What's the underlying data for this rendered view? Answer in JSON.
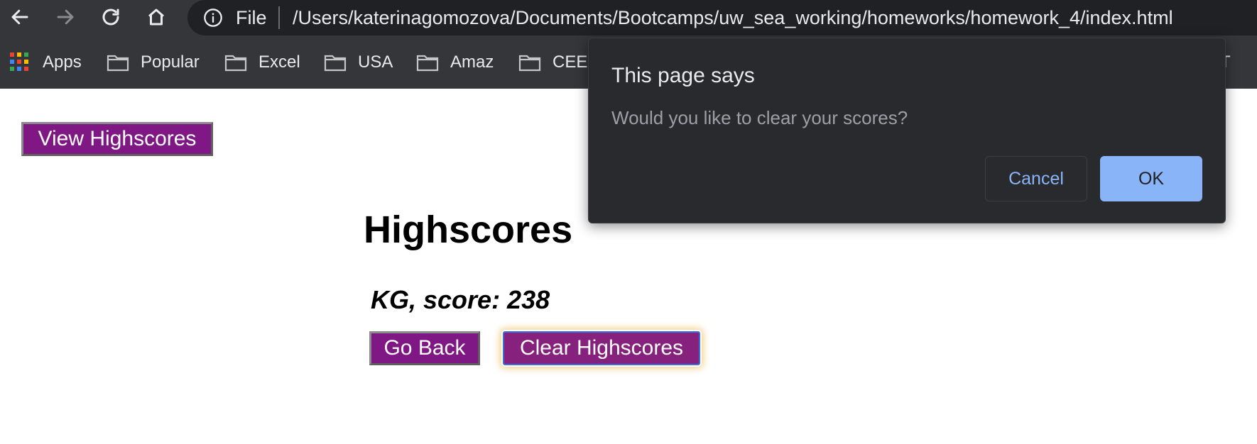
{
  "browser": {
    "scheme_label": "File",
    "url": "/Users/katerinagomozova/Documents/Bootcamps/uw_sea_working/homeworks/homework_4/index.html",
    "bookmarks": [
      {
        "label": "Apps",
        "icon": "apps-grid-icon"
      },
      {
        "label": "Popular",
        "icon": "folder-icon"
      },
      {
        "label": "Excel",
        "icon": "folder-icon"
      },
      {
        "label": "USA",
        "icon": "folder-icon"
      },
      {
        "label": "Amaz",
        "icon": "folder-icon"
      },
      {
        "label": "CEE",
        "icon": "folder-icon"
      },
      {
        "label": "T",
        "icon": "folder-icon"
      }
    ]
  },
  "page": {
    "view_highscores_label": "View Highscores",
    "heading": "Highscores",
    "score_line": "KG, score: 238",
    "go_back_label": "Go Back",
    "clear_highscores_label": "Clear Highscores",
    "button_color": "#7f1784"
  },
  "dialog": {
    "title": "This page says",
    "message": "Would you like to clear your scores?",
    "cancel_label": "Cancel",
    "ok_label": "OK",
    "accent_color": "#8ab4f8"
  }
}
